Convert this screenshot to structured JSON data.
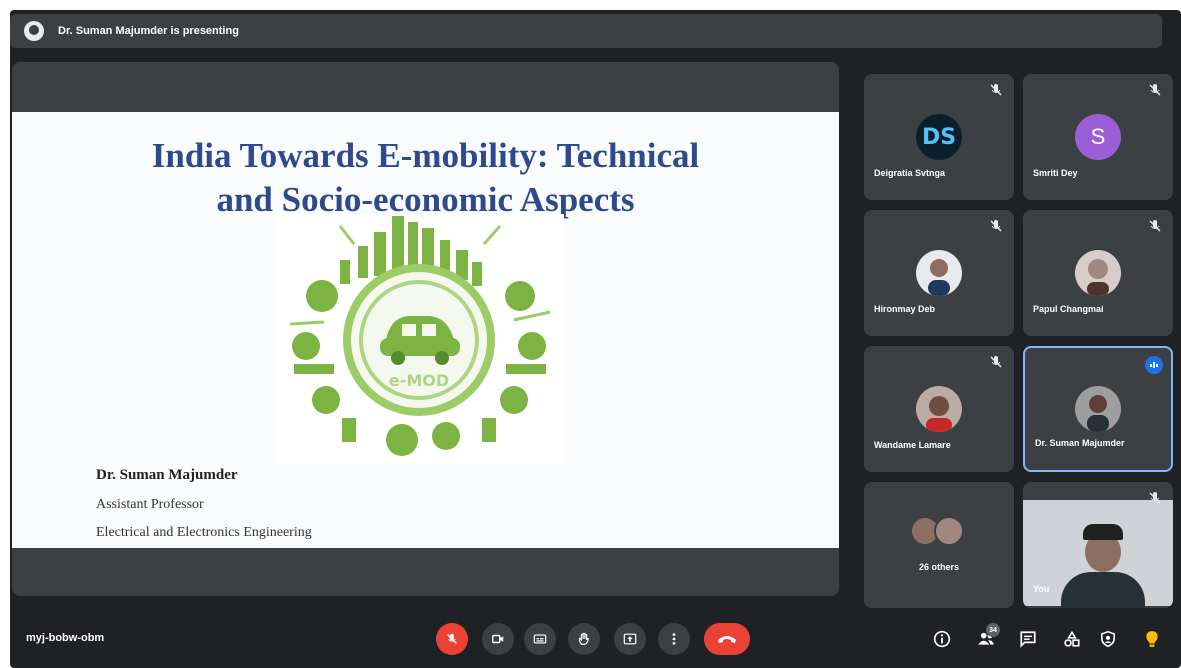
{
  "presenting": {
    "text": "Dr. Suman Majumder is presenting"
  },
  "slide": {
    "title_line1": "India Towards E-mobility: Technical",
    "title_line2": "and Socio-economic Aspects",
    "logo_text": "e-MOD",
    "presenter_name": "Dr. Suman Majumder",
    "presenter_role": "Assistant Professor",
    "presenter_dept": "Electrical and Electronics Engineering"
  },
  "participants": [
    {
      "name": "Deigratia Svtnga",
      "avatar": "DS",
      "avatar_type": "logo",
      "muted": true
    },
    {
      "name": "Smriti Dey",
      "avatar": "S",
      "avatar_type": "letter",
      "avatar_color": "#9c5ed6",
      "muted": true
    },
    {
      "name": "Hironmay Deb",
      "avatar_type": "photo",
      "muted": true
    },
    {
      "name": "Papul Changmai",
      "avatar_type": "photo",
      "muted": true
    },
    {
      "name": "Wandame Lamare",
      "avatar_type": "photo",
      "muted": true
    },
    {
      "name": "Dr. Suman Majumder",
      "avatar_type": "photo",
      "speaking": true
    },
    {
      "name": "26 others",
      "avatar_type": "group"
    },
    {
      "name": "You",
      "avatar_type": "video",
      "muted": true
    }
  ],
  "toolbar": {
    "meeting_code": "myj-bobw-obm",
    "people_count": "34",
    "buttons": [
      "mic-off-icon",
      "camera-icon",
      "captions-icon",
      "raise-hand-icon",
      "present-icon",
      "more-options-icon",
      "end-call-icon"
    ],
    "right_icons": [
      "info-icon",
      "people-icon",
      "chat-icon",
      "activities-icon",
      "host-controls-icon",
      "lightbulb-icon"
    ]
  },
  "colors": {
    "background": "#202124",
    "tile": "#3c4043",
    "accent_red": "#ea4335",
    "active_border": "#8ab4f8",
    "title_blue": "#2e4a8c"
  }
}
